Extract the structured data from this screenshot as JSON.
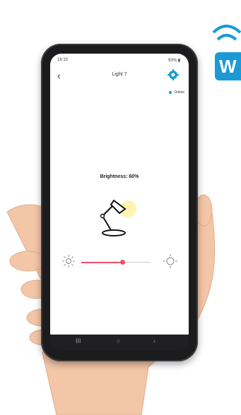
{
  "status_bar": {
    "time": "16:10",
    "right": "93% ▮"
  },
  "app_header": {
    "back_icon": "chevron-left-icon",
    "title": "Light 7",
    "settings_icon": "gear-icon"
  },
  "connection": {
    "status": "Online",
    "dot_color": "#1a9ad6"
  },
  "brightness": {
    "label": "Brightness: 60%",
    "value_percent": 60
  },
  "slider": {
    "value": 0.6,
    "active_color": "#e8506a"
  },
  "nav_bar": {
    "recent": "III",
    "home": "○",
    "back": "‹"
  },
  "badge": {
    "text": "W",
    "color": "#1a9ad6",
    "icon": "wifi-icon"
  }
}
